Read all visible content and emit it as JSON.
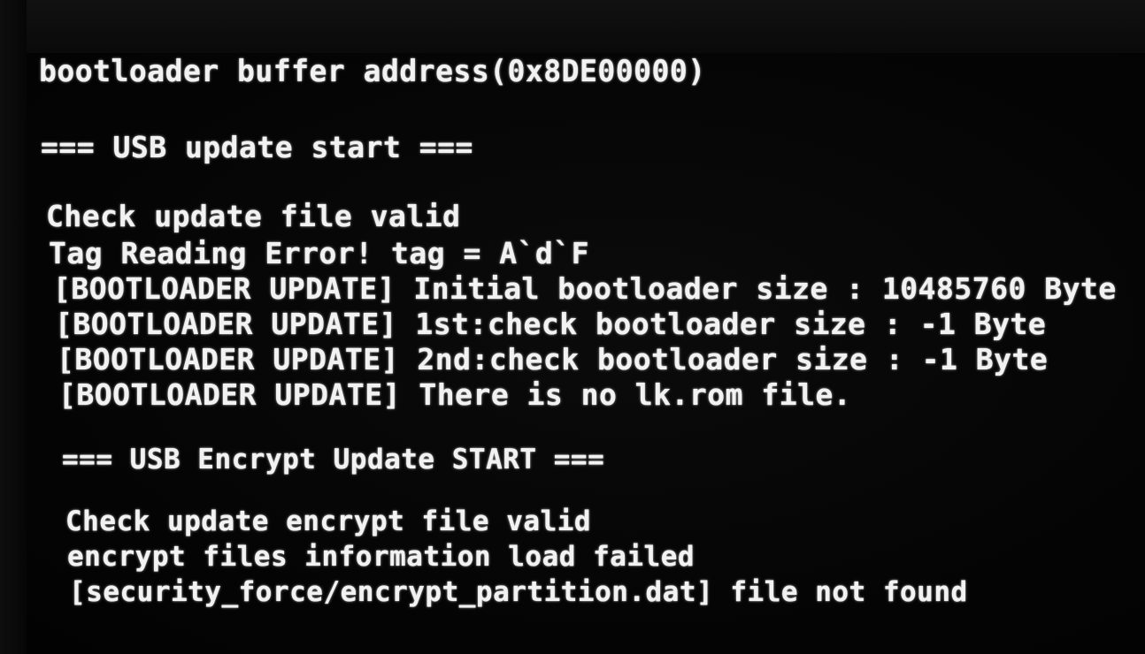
{
  "console": {
    "lines": [
      "bootloader buffer address(0x8DE00000)",
      "=== USB update start ===",
      "Check update file valid",
      "Tag Reading Error! tag = A`d`F",
      "[BOOTLOADER UPDATE] Initial bootloader size : 10485760 Byte",
      "[BOOTLOADER UPDATE] 1st:check bootloader size : -1 Byte",
      "[BOOTLOADER UPDATE] 2nd:check bootloader size : -1 Byte",
      "[BOOTLOADER UPDATE] There is no lk.rom file.",
      "=== USB Encrypt Update START ===",
      "Check update encrypt file valid",
      "encrypt files information load failed",
      "[security_force/encrypt_partition.dat] file not found"
    ]
  },
  "colors": {
    "background": "#050505",
    "text": "#f2f2f2"
  }
}
